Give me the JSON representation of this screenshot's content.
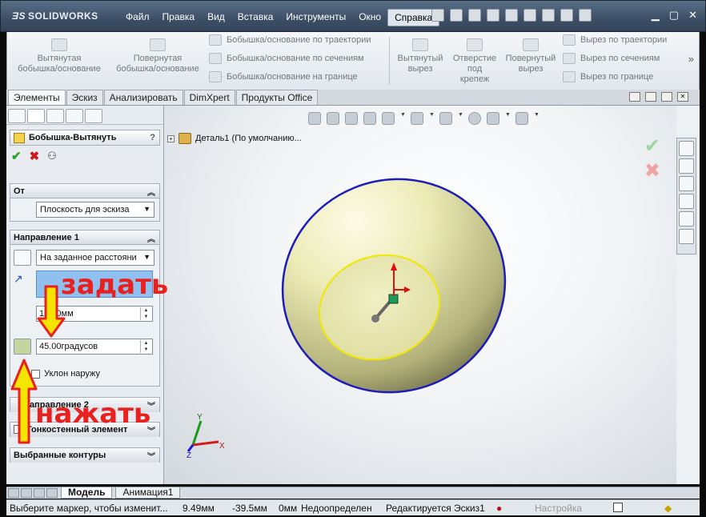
{
  "app": {
    "logo": "SOLIDWORKS",
    "menu": [
      "Файл",
      "Правка",
      "Вид",
      "Вставка",
      "Инструменты",
      "Окно",
      "Справка"
    ],
    "active_menu": "Справка"
  },
  "ribbon": {
    "big_buttons": [
      {
        "label": "Вытянутая\nбобышка/основание",
        "icon": "extruded-boss-icon"
      },
      {
        "label": "Повернутая\nбобышка/основание",
        "icon": "revolved-boss-icon"
      }
    ],
    "small_buttons_1": [
      {
        "label": "Бобышка/основание по траектории",
        "icon": "swept-boss-icon"
      },
      {
        "label": "Бобышка/основание по сечениям",
        "icon": "lofted-boss-icon"
      },
      {
        "label": "Бобышка/основание на границе",
        "icon": "boundary-boss-icon"
      }
    ],
    "cut_buttons": [
      {
        "label": "Вытянутый\nвырез",
        "icon": "extruded-cut-icon"
      },
      {
        "label": "Отверстие\nпод\nкрепеж",
        "icon": "hole-wizard-icon"
      },
      {
        "label": "Повернутый\nвырез",
        "icon": "revolved-cut-icon"
      }
    ],
    "small_buttons_2": [
      {
        "label": "Вырез по траектории",
        "icon": "swept-cut-icon"
      },
      {
        "label": "Вырез по сечениям",
        "icon": "lofted-cut-icon"
      },
      {
        "label": "Вырез по границе",
        "icon": "boundary-cut-icon"
      }
    ],
    "more": "»"
  },
  "tabs": [
    "Элементы",
    "Эскиз",
    "Анализировать",
    "DimXpert",
    "Продукты Office"
  ],
  "active_tab": "Элементы",
  "property_manager": {
    "title": "Бобышка-Вытянуть",
    "help": "?",
    "ok": "✔",
    "cancel": "✖",
    "preview": "⚇",
    "from": {
      "header": "От",
      "value": "Плоскость для эскиза"
    },
    "direction1": {
      "header": "Направление 1",
      "end_condition": "На заданное расстояни",
      "depth": "10.00мм",
      "draft_angle": "45.00градусов",
      "draft_outward": "Уклон наружу"
    },
    "direction2": {
      "header": "Направление 2"
    },
    "thin_feature": {
      "header": "Тонкостенный элемент"
    },
    "selected_contours": {
      "header": "Выбранные контуры"
    }
  },
  "viewport": {
    "tree_root": "Деталь1  (По умолчанию..."
  },
  "bottom_tabs": [
    "Модель",
    "Анимация1"
  ],
  "active_bottom_tab": "Модель",
  "status": {
    "hint": "Выберите маркер, чтобы изменит...",
    "x": "9.49мм",
    "y": "-39.5мм",
    "z": "0мм",
    "state": "Недоопределен",
    "editing": "Редактируется Эскиз1",
    "custom": "Настройка"
  },
  "annotations": {
    "set": "задать",
    "press": "нажать"
  },
  "colors": {
    "annotation": "#e8211f",
    "arrow_fill": "#f5e300",
    "model_edge": "#1c1cb8",
    "sketch_edge": "#f0e800"
  }
}
